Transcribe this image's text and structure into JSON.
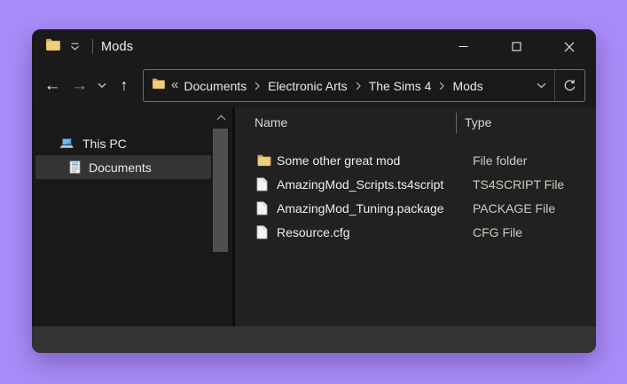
{
  "titlebar": {
    "title": "Mods"
  },
  "toolbar": {
    "back_glyph": "←",
    "forward_glyph": "→",
    "up_glyph": "↑",
    "address": {
      "overflow_glyph": "«",
      "crumbs": [
        {
          "label": "Documents"
        },
        {
          "label": "Electronic Arts"
        },
        {
          "label": "The Sims 4"
        },
        {
          "label": "Mods"
        }
      ]
    }
  },
  "sidebar": {
    "items": [
      {
        "label": "This PC",
        "icon": "pc-icon",
        "selected": false
      },
      {
        "label": "Documents",
        "icon": "document-icon",
        "selected": true
      }
    ]
  },
  "files": {
    "columns": [
      {
        "label": "Name"
      },
      {
        "label": "Type"
      }
    ],
    "rows": [
      {
        "icon": "folder-icon",
        "name": "Some other great mod",
        "type": "File folder"
      },
      {
        "icon": "file-icon",
        "name": "AmazingMod_Scripts.ts4script",
        "type": "TS4SCRIPT File"
      },
      {
        "icon": "file-icon",
        "name": "AmazingMod_Tuning.package",
        "type": "PACKAGE File"
      },
      {
        "icon": "file-icon",
        "name": "Resource.cfg",
        "type": "CFG File"
      }
    ]
  },
  "colors": {
    "desktop_background": "#aa8cf8",
    "window_chrome": "#1a1a1a",
    "sidebar_background": "#191919",
    "pane_background": "#212121",
    "status_bar": "#333333",
    "selection": "#343434",
    "folder_yellow": "#eac26d",
    "name_text": "#ededed",
    "type_text": "#d0c9bd"
  }
}
